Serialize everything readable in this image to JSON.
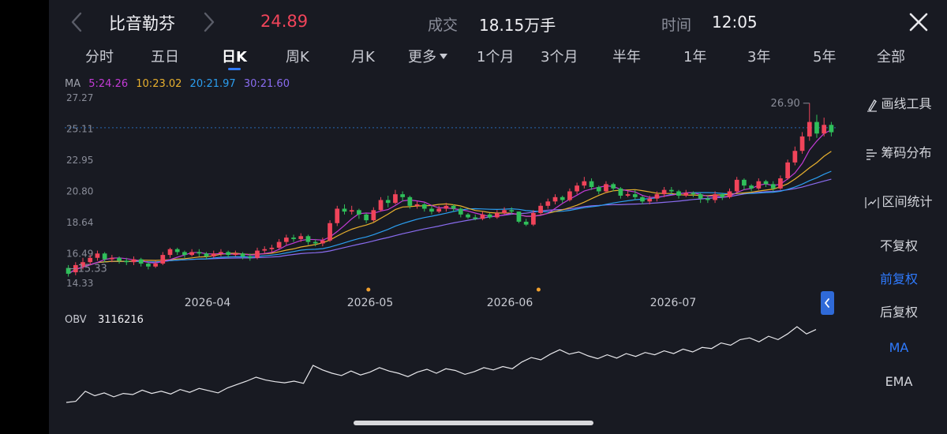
{
  "header": {
    "stock_name": "比音勒芬",
    "price": "24.89",
    "volume_label": "成交",
    "volume_value": "18.15万手",
    "time_label": "时间",
    "time_value": "12:05"
  },
  "tabs": [
    {
      "label": "分时",
      "active": false
    },
    {
      "label": "五日",
      "active": false
    },
    {
      "label": "日K",
      "active": true
    },
    {
      "label": "周K",
      "active": false
    },
    {
      "label": "月K",
      "active": false
    },
    {
      "label": "更多",
      "active": false,
      "dropdown": true
    },
    {
      "label": "1个月",
      "active": false
    },
    {
      "label": "3个月",
      "active": false
    },
    {
      "label": "半年",
      "active": false
    },
    {
      "label": "1年",
      "active": false
    },
    {
      "label": "3年",
      "active": false
    },
    {
      "label": "5年",
      "active": false
    },
    {
      "label": "全部",
      "active": false
    }
  ],
  "ma_legend": {
    "label": "MA",
    "items": [
      {
        "text": "5:24.26",
        "color": "#c33bd6"
      },
      {
        "text": "10:23.02",
        "color": "#e8b02e"
      },
      {
        "text": "20:21.97",
        "color": "#2b9ef0"
      },
      {
        "text": "30:21.60",
        "color": "#8a6cf0"
      }
    ]
  },
  "right_panel": {
    "draw_tools": "画线工具",
    "chip_distribution": "筹码分布",
    "interval_stats": "区间统计",
    "no_adjust": "不复权",
    "forward_adjust": "前复权",
    "backward_adjust": "后复权",
    "ma": "MA",
    "ema": "EMA"
  },
  "obv": {
    "label": "OBV",
    "value": "3116216"
  },
  "colors": {
    "up": "#f0445a",
    "down": "#2fbf5a",
    "accent": "#2f7bff",
    "background": "#181a22"
  },
  "chart_data": {
    "type": "candlestick",
    "price_ticks": [
      "27.27",
      "25.11",
      "22.95",
      "20.80",
      "18.64",
      "16.49",
      "14.33"
    ],
    "ylim": [
      14.33,
      27.27
    ],
    "dates": [
      "2026-04",
      "2026-05",
      "2026-06",
      "2026-07"
    ],
    "high_label": "26.90",
    "low_label": "15.33",
    "last_price_line": 25.2,
    "candles": [
      [
        15.5,
        15.1,
        15.7,
        14.9
      ],
      [
        15.2,
        15.7,
        15.9,
        15.0
      ],
      [
        15.6,
        15.9,
        16.2,
        15.4
      ],
      [
        15.9,
        16.2,
        16.4,
        15.7
      ],
      [
        16.2,
        16.5,
        16.7,
        16.0
      ],
      [
        16.5,
        16.1,
        16.6,
        15.9
      ],
      [
        16.1,
        16.2,
        16.4,
        15.9
      ],
      [
        16.2,
        16.0,
        16.3,
        15.8
      ],
      [
        16.0,
        15.9,
        16.2,
        15.7
      ],
      [
        15.9,
        16.1,
        16.3,
        15.7
      ],
      [
        16.1,
        15.8,
        16.2,
        15.6
      ],
      [
        15.8,
        15.6,
        15.9,
        15.4
      ],
      [
        15.6,
        15.8,
        16.0,
        15.5
      ],
      [
        15.8,
        16.4,
        16.6,
        15.7
      ],
      [
        16.4,
        16.8,
        16.9,
        16.2
      ],
      [
        16.8,
        16.6,
        16.9,
        16.4
      ],
      [
        16.6,
        16.4,
        16.7,
        16.2
      ],
      [
        16.4,
        16.6,
        16.8,
        16.3
      ],
      [
        16.6,
        16.5,
        16.8,
        16.3
      ],
      [
        16.5,
        16.3,
        16.6,
        16.1
      ],
      [
        16.3,
        16.5,
        16.7,
        16.2
      ],
      [
        16.5,
        16.6,
        16.8,
        16.3
      ],
      [
        16.6,
        16.4,
        16.7,
        16.2
      ],
      [
        16.4,
        16.5,
        16.7,
        16.3
      ],
      [
        16.5,
        16.3,
        16.6,
        16.1
      ],
      [
        16.3,
        16.2,
        16.5,
        16.0
      ],
      [
        16.2,
        16.7,
        16.9,
        16.1
      ],
      [
        16.7,
        16.8,
        17.0,
        16.5
      ],
      [
        16.8,
        16.9,
        17.1,
        16.6
      ],
      [
        16.9,
        17.3,
        17.5,
        16.8
      ],
      [
        17.3,
        17.6,
        17.8,
        17.1
      ],
      [
        17.6,
        17.5,
        17.8,
        17.3
      ],
      [
        17.5,
        17.7,
        17.9,
        17.3
      ],
      [
        17.7,
        17.3,
        17.8,
        17.1
      ],
      [
        17.3,
        17.2,
        17.5,
        17.0
      ],
      [
        17.2,
        17.4,
        17.6,
        17.0
      ],
      [
        17.4,
        18.6,
        18.8,
        17.3
      ],
      [
        18.6,
        19.6,
        19.8,
        18.4
      ],
      [
        19.6,
        19.4,
        19.9,
        19.2
      ],
      [
        19.4,
        19.5,
        19.8,
        19.2
      ],
      [
        19.5,
        19.2,
        19.6,
        18.9
      ],
      [
        19.2,
        18.8,
        19.3,
        18.6
      ],
      [
        18.8,
        19.5,
        19.7,
        18.7
      ],
      [
        19.5,
        20.2,
        20.4,
        19.4
      ],
      [
        20.2,
        20.0,
        20.5,
        19.7
      ],
      [
        20.0,
        20.6,
        20.9,
        19.9
      ],
      [
        20.6,
        20.4,
        20.8,
        20.1
      ],
      [
        20.4,
        19.8,
        20.5,
        19.6
      ],
      [
        19.8,
        19.9,
        20.1,
        19.6
      ],
      [
        19.9,
        19.6,
        20.0,
        19.4
      ],
      [
        19.6,
        19.4,
        19.8,
        19.2
      ],
      [
        19.4,
        19.6,
        19.8,
        19.3
      ],
      [
        19.6,
        19.8,
        20.0,
        19.4
      ],
      [
        19.8,
        19.6,
        19.9,
        19.4
      ],
      [
        19.6,
        19.2,
        19.7,
        19.0
      ],
      [
        19.2,
        19.0,
        19.3,
        18.9
      ],
      [
        19.0,
        18.9,
        19.2,
        18.8
      ],
      [
        18.9,
        19.2,
        19.4,
        18.8
      ],
      [
        19.2,
        19.0,
        19.3,
        18.9
      ],
      [
        19.0,
        19.3,
        19.5,
        18.9
      ],
      [
        19.3,
        19.5,
        19.7,
        19.2
      ],
      [
        19.5,
        19.4,
        19.7,
        19.2
      ],
      [
        19.4,
        18.7,
        19.4,
        18.6
      ],
      [
        18.7,
        18.5,
        18.9,
        18.4
      ],
      [
        18.5,
        19.3,
        19.5,
        18.4
      ],
      [
        19.3,
        19.8,
        20.0,
        19.2
      ],
      [
        19.8,
        20.1,
        20.3,
        19.6
      ],
      [
        20.1,
        20.4,
        20.6,
        19.9
      ],
      [
        20.4,
        20.2,
        20.5,
        20.0
      ],
      [
        20.2,
        20.8,
        21.0,
        20.1
      ],
      [
        20.8,
        21.2,
        21.4,
        20.6
      ],
      [
        21.2,
        21.5,
        21.8,
        21.0
      ],
      [
        21.5,
        21.1,
        21.7,
        20.9
      ],
      [
        21.1,
        20.8,
        21.2,
        20.6
      ],
      [
        20.8,
        21.3,
        21.5,
        20.7
      ],
      [
        21.3,
        21.0,
        21.4,
        20.8
      ],
      [
        21.0,
        20.5,
        21.1,
        20.3
      ],
      [
        20.5,
        20.6,
        20.8,
        20.4
      ],
      [
        20.6,
        20.4,
        20.9,
        20.2
      ],
      [
        20.4,
        20.1,
        20.5,
        19.9
      ],
      [
        20.1,
        20.3,
        20.5,
        19.9
      ],
      [
        20.3,
        20.6,
        20.8,
        20.1
      ],
      [
        20.6,
        20.9,
        21.1,
        20.4
      ],
      [
        20.9,
        20.8,
        21.1,
        20.6
      ],
      [
        20.8,
        20.5,
        20.9,
        20.3
      ],
      [
        20.5,
        20.7,
        20.9,
        20.4
      ],
      [
        20.7,
        20.6,
        20.8,
        20.4
      ],
      [
        20.6,
        20.3,
        20.7,
        20.0
      ],
      [
        20.3,
        20.2,
        20.5,
        20.0
      ],
      [
        20.2,
        20.6,
        20.8,
        20.0
      ],
      [
        20.6,
        20.4,
        20.7,
        20.2
      ],
      [
        20.4,
        20.8,
        21.0,
        20.3
      ],
      [
        20.8,
        21.6,
        21.8,
        20.7
      ],
      [
        21.6,
        21.2,
        21.7,
        20.9
      ],
      [
        21.2,
        21.0,
        21.3,
        20.8
      ],
      [
        21.0,
        21.5,
        21.7,
        20.9
      ],
      [
        21.5,
        21.3,
        21.6,
        21.1
      ],
      [
        21.3,
        21.0,
        21.5,
        20.8
      ],
      [
        21.0,
        21.7,
        21.9,
        20.9
      ],
      [
        21.7,
        22.8,
        23.0,
        21.6
      ],
      [
        22.8,
        23.6,
        23.9,
        22.6
      ],
      [
        23.6,
        24.6,
        24.9,
        23.4
      ],
      [
        24.6,
        25.6,
        26.9,
        24.3
      ],
      [
        25.6,
        24.8,
        26.1,
        24.5
      ],
      [
        24.8,
        25.4,
        25.9,
        24.6
      ],
      [
        25.4,
        24.89,
        25.6,
        24.6
      ]
    ],
    "obv_series": [
      10,
      12,
      30,
      22,
      27,
      20,
      26,
      24,
      32,
      26,
      30,
      25,
      33,
      28,
      35,
      31,
      27,
      36,
      42,
      48,
      55,
      50,
      47,
      45,
      48,
      44,
      76,
      68,
      62,
      58,
      66,
      59,
      64,
      72,
      66,
      62,
      56,
      64,
      69,
      62,
      70,
      67,
      60,
      65,
      72,
      68,
      74,
      70,
      82,
      90,
      86,
      96,
      104,
      96,
      100,
      93,
      88,
      95,
      89,
      97,
      92,
      99,
      95,
      102,
      97,
      105,
      100,
      108,
      106,
      116,
      112,
      122,
      125,
      118,
      128,
      122,
      132,
      145,
      132,
      140
    ],
    "obv_markers": [
      0.26,
      0.48
    ]
  }
}
